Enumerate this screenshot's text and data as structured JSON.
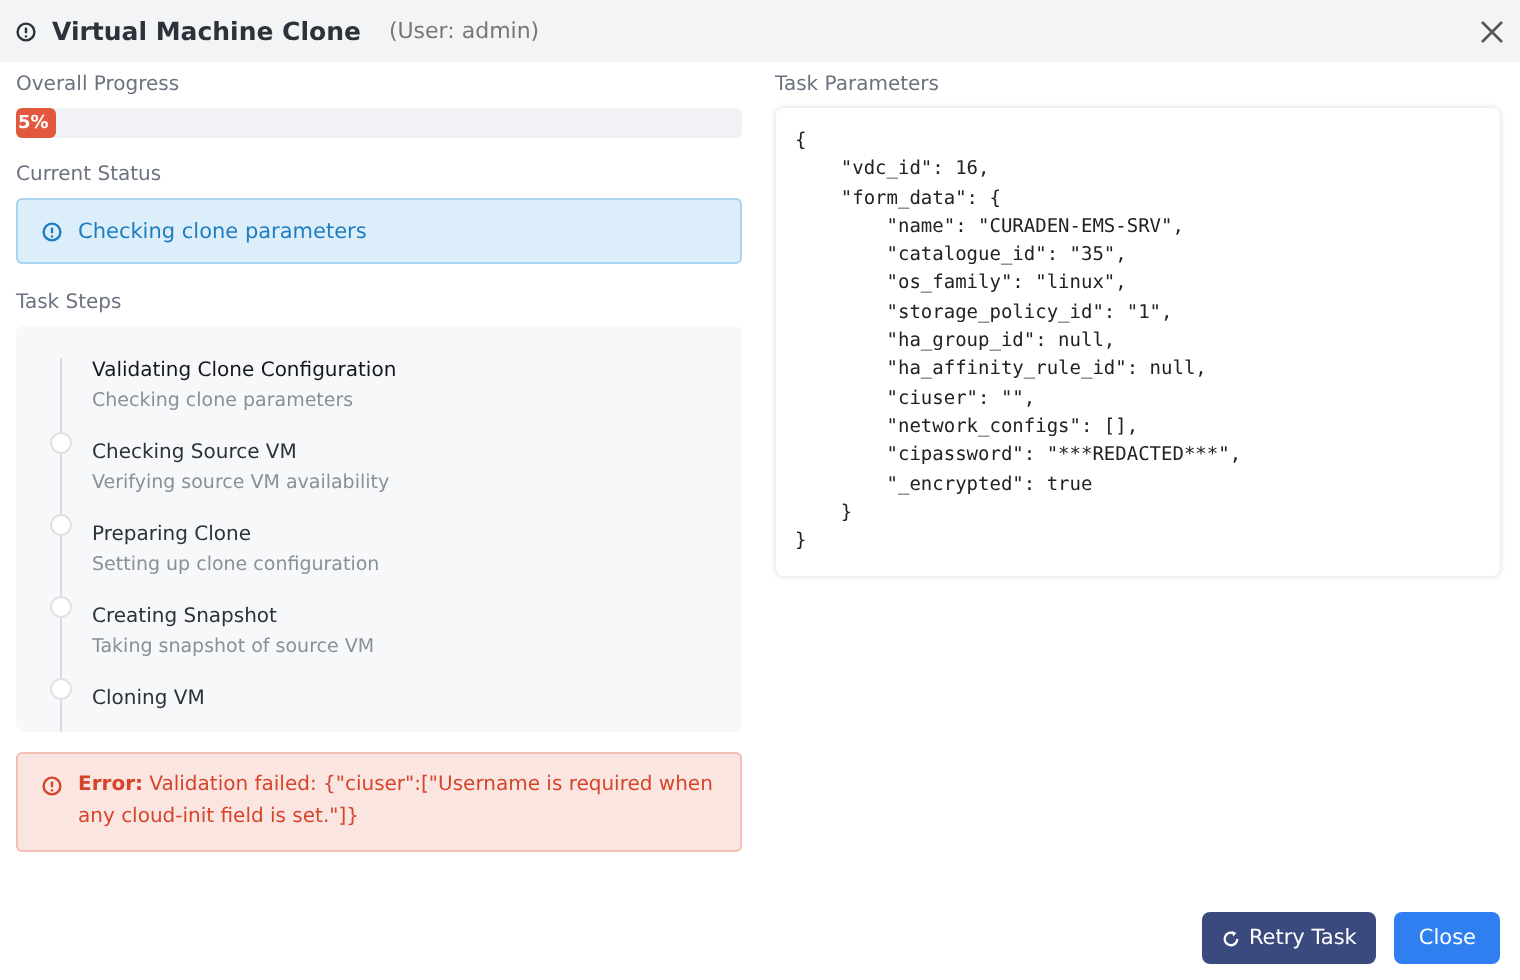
{
  "dialog": {
    "title": "Virtual Machine Clone",
    "user": "(User: admin)"
  },
  "progress": {
    "label": "Overall Progress",
    "level": 0.05,
    "reading": "5%"
  },
  "status": {
    "label": "Current Status",
    "message": "Checking clone parameters"
  },
  "steps": {
    "label": "Task Steps",
    "items": [
      {
        "title": "Validating Clone Configuration",
        "description": "Checking clone parameters",
        "active": true
      },
      {
        "title": "Checking Source VM",
        "description": "Verifying source VM availability",
        "active": false
      },
      {
        "title": "Preparing Clone",
        "description": "Setting up clone configuration",
        "active": false
      },
      {
        "title": "Creating Snapshot",
        "description": "Taking snapshot of source VM",
        "active": false
      },
      {
        "title": "Cloning VM",
        "active": false
      }
    ]
  },
  "error": {
    "text": "**Error:** Validation failed: {\"ciuser\":[\"Username is required when any cloud-init field is set.\"]}"
  },
  "parameters": {
    "label": "Task Parameters",
    "lines": [
      "{",
      "    \"vdc_id\": 16,",
      "    \"form_data\": {",
      "        \"name\": \"CURADEN-EMS-SRV\",",
      "        \"catalogue_id\": \"35\",",
      "        \"os_family\": \"linux\",",
      "        \"storage_policy_id\": \"1\",",
      "        \"ha_group_id\": null,",
      "        \"ha_affinity_rule_id\": null,",
      "        \"ciuser\": \"\",",
      "        \"network_configs\": [],",
      "        \"cipassword\": \"***REDACTED***\",",
      "        \"_encrypted\": true",
      "    }",
      "}"
    ]
  },
  "buttons": [
    {
      "label": "Retry Task",
      "kind": "retry"
    },
    {
      "label": "Close",
      "kind": "primary"
    }
  ]
}
